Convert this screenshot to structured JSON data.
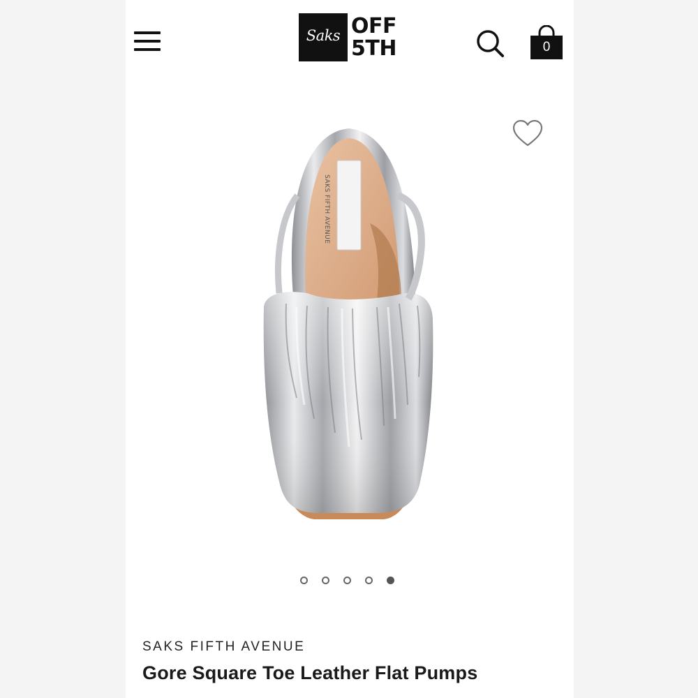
{
  "header": {
    "logo_script": "Saks",
    "logo_line1": "OFF",
    "logo_line2": "5TH",
    "bag_count": "0"
  },
  "carousel": {
    "total": 5,
    "active_index": 4
  },
  "product": {
    "brand": "SAKS FIFTH AVENUE",
    "name": "Gore Square Toe Leather Flat Pumps",
    "insole_label": "SAKS FIFTH AVENUE"
  },
  "colors": {
    "text_primary": "#111111",
    "background": "#ffffff",
    "dot_active": "#555555"
  },
  "icons": [
    "menu-icon",
    "search-icon",
    "shopping-bag-icon",
    "heart-icon"
  ]
}
